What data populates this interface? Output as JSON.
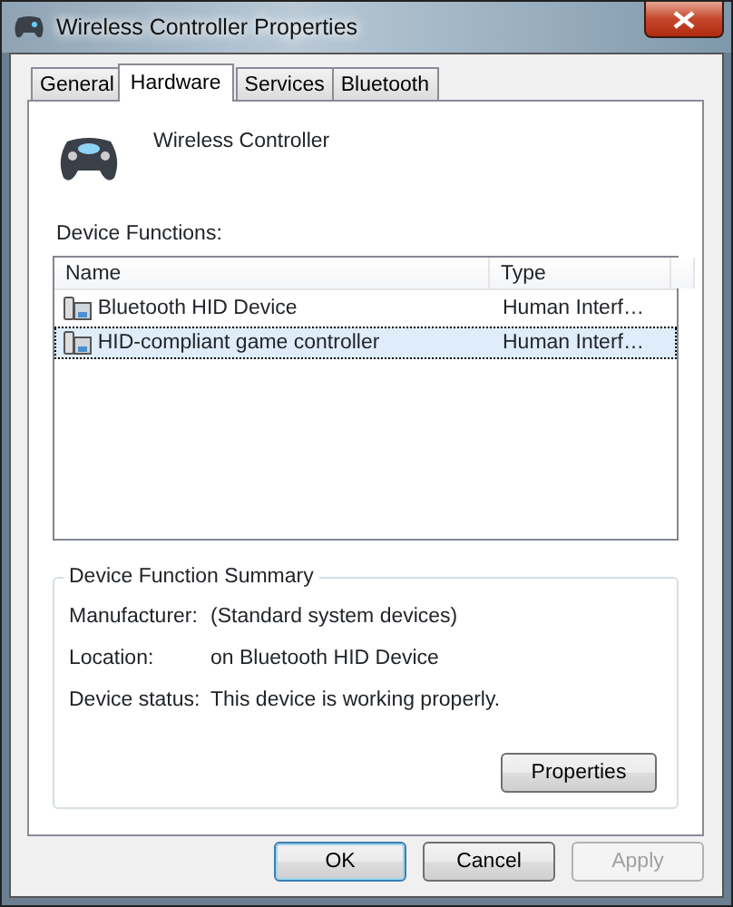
{
  "window": {
    "title": "Wireless Controller Properties"
  },
  "tabs": [
    {
      "label": "General",
      "selected": false
    },
    {
      "label": "Hardware",
      "selected": true
    },
    {
      "label": "Services",
      "selected": false
    },
    {
      "label": "Bluetooth",
      "selected": false
    }
  ],
  "device": {
    "name": "Wireless Controller"
  },
  "functions": {
    "label": "Device Functions:",
    "columns": [
      "Name",
      "Type"
    ],
    "rows": [
      {
        "name": "Bluetooth HID Device",
        "type": "Human Interf…",
        "selected": false
      },
      {
        "name": "HID-compliant game controller",
        "type": "Human Interf…",
        "selected": true
      }
    ]
  },
  "summary": {
    "title": "Device Function Summary",
    "fields": [
      {
        "label": "Manufacturer:",
        "value": "(Standard system devices)"
      },
      {
        "label": "Location:",
        "value": "on Bluetooth HID Device"
      },
      {
        "label": "Device status:",
        "value": "This device is working properly."
      }
    ],
    "button": "Properties"
  },
  "buttons": [
    {
      "label": "OK",
      "kind": "default",
      "disabled": false
    },
    {
      "label": "Cancel",
      "kind": "normal",
      "disabled": false
    },
    {
      "label": "Apply",
      "kind": "normal",
      "disabled": true
    }
  ]
}
